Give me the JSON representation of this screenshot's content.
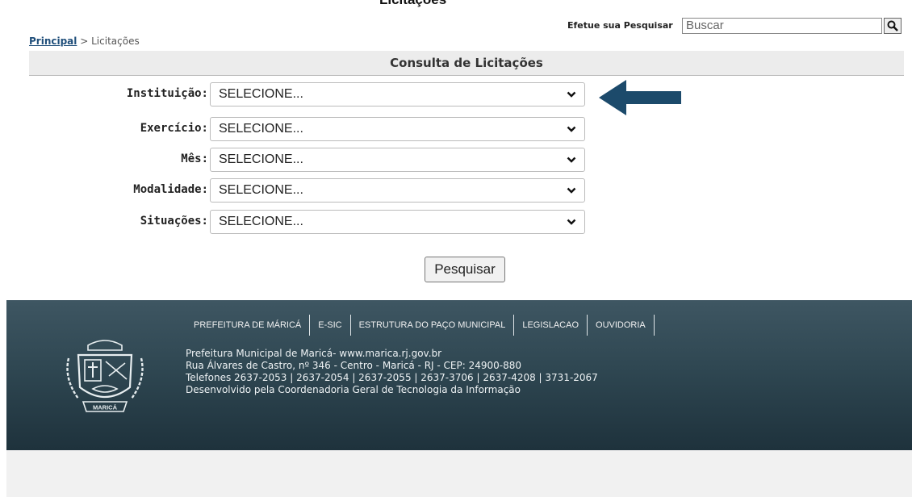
{
  "header": {
    "cutoff_heading": "Licitações",
    "search_label": "Efetue sua Pesquisar",
    "search_placeholder": "Buscar"
  },
  "breadcrumb": {
    "home": "Principal",
    "separator": ">",
    "current": "Licitações"
  },
  "page_title": "Consulta de Licitações",
  "form": {
    "fields": [
      {
        "label": "Instituição:",
        "value": "SELECIONE..."
      },
      {
        "label": "Exercício:",
        "value": "SELECIONE..."
      },
      {
        "label": "Mês:",
        "value": "SELECIONE..."
      },
      {
        "label": "Modalidade:",
        "value": "SELECIONE..."
      },
      {
        "label": "Situações:",
        "value": "SELECIONE..."
      }
    ],
    "submit_label": "Pesquisar"
  },
  "footer": {
    "nav": [
      "PREFEITURA DE MÁRICÁ",
      "E-SIC",
      "ESTRUTURA DO PAÇO MUNICIPAL",
      "LEGISLACAO",
      "OUVIDORIA"
    ],
    "lines": [
      "Prefeitura Municipal de Maricá- www.marica.rj.gov.br",
      "Rua Álvares de Castro, nº 346 - Centro - Maricá - RJ - CEP: 24900-880",
      "Telefones 2637-2053 | 2637-2054 | 2637-2055 | 2637-3706 | 2637-4208 | 3731-2067",
      "Desenvolvido pela Coordenadoria Geral de Tecnologia da Informação"
    ],
    "crest_text": "MARICÁ"
  },
  "colors": {
    "arrow": "#1c4a6b",
    "footer_bg": "#2f4752",
    "link": "#1f4e7a"
  }
}
